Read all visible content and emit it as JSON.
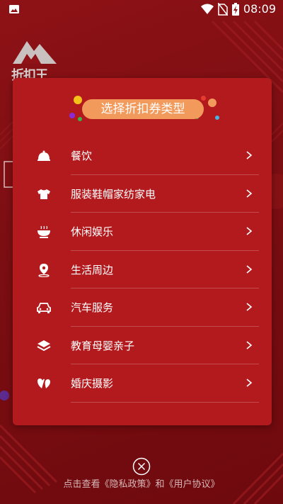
{
  "status_bar": {
    "time": "08:09",
    "icons": [
      "image-icon",
      "wifi-icon",
      "no-sim-icon",
      "battery-charging-icon"
    ]
  },
  "background": {
    "logo_text": "折扣王"
  },
  "dialog": {
    "title": "选择折扣券类型",
    "items": [
      {
        "label": "餐饮",
        "icon": "dining-cloche-icon"
      },
      {
        "label": "服装鞋帽家纺家电",
        "icon": "tshirt-icon"
      },
      {
        "label": "休闲娱乐",
        "icon": "bowl-icon"
      },
      {
        "label": "生活周边",
        "icon": "location-pin-icon"
      },
      {
        "label": "汽车服务",
        "icon": "car-icon"
      },
      {
        "label": "教育母婴亲子",
        "icon": "layers-icon"
      },
      {
        "label": "婚庆摄影",
        "icon": "double-heart-icon"
      }
    ]
  },
  "footer": {
    "text": "点击查看《隐私政策》和《用户协议》"
  },
  "colors": {
    "background": "#7c0e12",
    "dialog": "#b31a1e",
    "title_pill": "#f29a5b"
  }
}
